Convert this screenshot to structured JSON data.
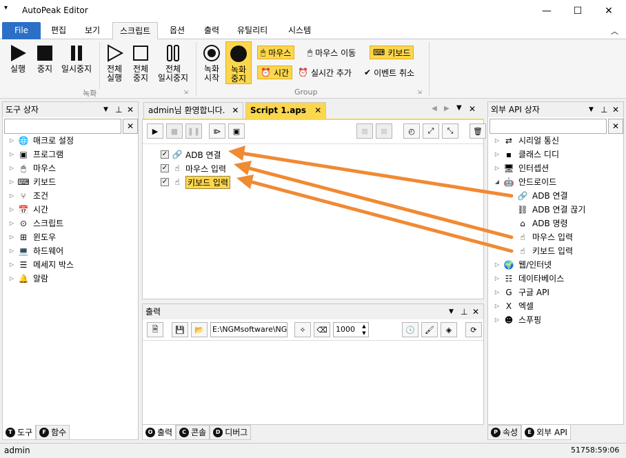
{
  "window": {
    "title": "AutoPeak Editor"
  },
  "ribbon_tabs": [
    {
      "label": "File"
    },
    {
      "label": "편집"
    },
    {
      "label": "보기"
    },
    {
      "label": "스크립트"
    },
    {
      "label": "옵션"
    },
    {
      "label": "출력"
    },
    {
      "label": "유틸리티"
    },
    {
      "label": "시스템"
    }
  ],
  "ribbon": {
    "run": "실행",
    "stop": "중지",
    "pause": "일시중지",
    "all_run_1": "전체",
    "all_run_2": "실행",
    "all_stop_1": "전체",
    "all_stop_2": "중지",
    "all_pause_1": "전체",
    "all_pause_2": "일시중지",
    "group_record": "녹화",
    "rec_start_1": "녹화",
    "rec_start_2": "시작",
    "rec_stop_1": "녹화",
    "rec_stop_2": "중지",
    "mouse": "마우스",
    "mouse_move": "마우스 이동",
    "keyboard": "키보드",
    "time": "시간",
    "realtime_add": "실시간 추가",
    "event_cancel": "이벤트 취소",
    "group_group": "Group"
  },
  "tool_panel": {
    "title": "도구 상자",
    "items": [
      {
        "label": "매크로 설정",
        "icon": "globe-icon"
      },
      {
        "label": "프로그램",
        "icon": "program-icon"
      },
      {
        "label": "마우스",
        "icon": "mouse-icon"
      },
      {
        "label": "키보드",
        "icon": "keyboard-icon"
      },
      {
        "label": "조건",
        "icon": "condition-icon"
      },
      {
        "label": "시간",
        "icon": "calendar-icon"
      },
      {
        "label": "스크립트",
        "icon": "script-icon"
      },
      {
        "label": "윈도우",
        "icon": "windows-icon"
      },
      {
        "label": "하드웨어",
        "icon": "laptop-icon"
      },
      {
        "label": "메세지 박스",
        "icon": "message-icon"
      },
      {
        "label": "알람",
        "icon": "bell-icon"
      }
    ],
    "tabs": [
      {
        "letter": "T",
        "label": "도구"
      },
      {
        "letter": "F",
        "label": "함수"
      }
    ]
  },
  "doc_tabs": [
    {
      "label": "admin님 환영합니다."
    },
    {
      "label": "Script 1.aps"
    }
  ],
  "script_items": [
    {
      "label": "ADB 연결",
      "icon": "link-icon",
      "checked": true
    },
    {
      "label": "마우스 입력",
      "icon": "hand-pointer-icon",
      "checked": true
    },
    {
      "label": "키보드 입력",
      "icon": "hand-pointer-icon",
      "checked": true
    }
  ],
  "output_panel": {
    "title": "출력",
    "path": "E:\\NGMsoftware\\NG",
    "number": "1000",
    "tabs": [
      {
        "letter": "O",
        "label": "출력"
      },
      {
        "letter": "C",
        "label": "콘솔"
      },
      {
        "letter": "D",
        "label": "디버그"
      }
    ]
  },
  "api_panel": {
    "title": "외부 API 상자",
    "items": [
      {
        "label": "시리얼 통신",
        "icon": "serial-icon",
        "level": 0,
        "exp": "closed"
      },
      {
        "label": "클래스 디디",
        "icon": "class-icon",
        "level": 0,
        "exp": "closed"
      },
      {
        "label": "인터셉션",
        "icon": "monitor-icon",
        "level": 0,
        "exp": "closed"
      },
      {
        "label": "안드로이드",
        "icon": "android-icon",
        "level": 0,
        "exp": "open"
      },
      {
        "label": "ADB 연결",
        "icon": "link-icon",
        "level": 1,
        "exp": "none"
      },
      {
        "label": "ADB 연결 끊기",
        "icon": "unlink-icon",
        "level": 1,
        "exp": "none"
      },
      {
        "label": "ADB 명령",
        "icon": "home-icon",
        "level": 1,
        "exp": "none"
      },
      {
        "label": "마우스 입력",
        "icon": "hand-pointer-icon",
        "level": 1,
        "exp": "none"
      },
      {
        "label": "키보드 입력",
        "icon": "hand-pointer-icon",
        "level": 1,
        "exp": "none"
      },
      {
        "label": "웹/인터넷",
        "icon": "web-icon",
        "level": 0,
        "exp": "closed"
      },
      {
        "label": "데이타베이스",
        "icon": "database-icon",
        "level": 0,
        "exp": "closed"
      },
      {
        "label": "구글 API",
        "icon": "google-icon",
        "level": 0,
        "exp": "closed"
      },
      {
        "label": "엑셀",
        "icon": "excel-icon",
        "level": 0,
        "exp": "closed"
      },
      {
        "label": "스푸핑",
        "icon": "mask-icon",
        "level": 0,
        "exp": "closed"
      }
    ],
    "tabs": [
      {
        "letter": "P",
        "label": "속성"
      },
      {
        "letter": "E",
        "label": "외부 API"
      }
    ]
  },
  "status": {
    "user": "admin",
    "time": "51758:59:06"
  },
  "colors": {
    "accent": "#2b70c6",
    "highlight": "#fcd74d",
    "arrow": "#f08a33"
  }
}
